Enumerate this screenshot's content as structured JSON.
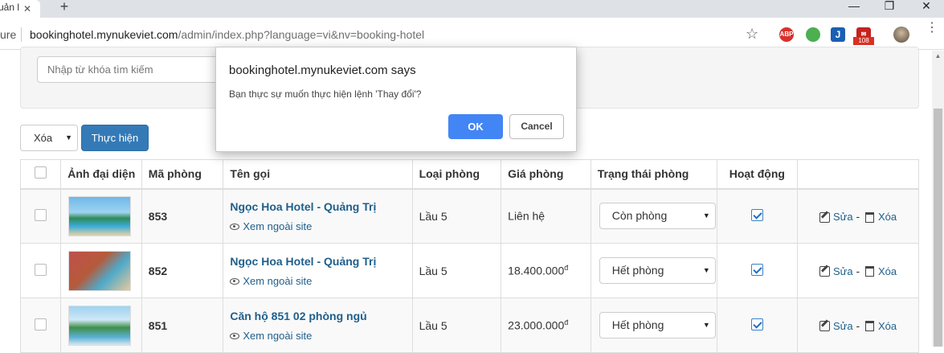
{
  "browser": {
    "tab_title": "uản l",
    "tab_close": "✕",
    "new_tab": "+",
    "url_prefix": "ure",
    "url_domain": "bookinghotel.mynukeviet.com",
    "url_path": "/admin/index.php?language=vi&nv=booking-hotel",
    "ext_abp": "ABP",
    "ext_j": "J",
    "ext_badge": "108"
  },
  "search": {
    "placeholder": "Nhập từ khóa tìm kiếm"
  },
  "bulk": {
    "action_value": "Xóa",
    "execute_label": "Thực hiện"
  },
  "table": {
    "headers": {
      "image": "Ảnh đại diện",
      "code": "Mã phòng",
      "name": "Tên gọi",
      "type": "Loại phòng",
      "price": "Giá phòng",
      "status": "Trạng thái phòng",
      "active": "Hoạt động"
    },
    "rows": [
      {
        "code": "853",
        "name": "Ngọc Hoa Hotel - Quảng Trị",
        "view_site": "Xem ngoài site",
        "type": "Lầu 5",
        "price": "Liên hệ",
        "currency": "",
        "status": "Còn phòng",
        "active": true,
        "edit": "Sửa",
        "delete": "Xóa"
      },
      {
        "code": "852",
        "name": "Ngọc Hoa Hotel - Quảng Trị",
        "view_site": "Xem ngoài site",
        "type": "Lầu 5",
        "price": "18.400.000",
        "currency": "đ",
        "status": "Hết phòng",
        "active": true,
        "edit": "Sửa",
        "delete": "Xóa"
      },
      {
        "code": "851",
        "name": "Căn hộ 851 02 phòng ngủ",
        "view_site": "Xem ngoài site",
        "type": "Lầu 5",
        "price": "23.000.000",
        "currency": "đ",
        "status": "Hết phòng",
        "active": true,
        "edit": "Sửa",
        "delete": "Xóa"
      }
    ],
    "separator": "-"
  },
  "dialog": {
    "title": "bookinghotel.mynukeviet.com says",
    "message": "Bạn thực sự muốn thực hiện lệnh 'Thay đổi'?",
    "ok_label": "OK",
    "cancel_label": "Cancel"
  },
  "colors": {
    "primary": "#337ab7",
    "dialog_ok": "#4285f4",
    "link": "#1f5f8b"
  }
}
